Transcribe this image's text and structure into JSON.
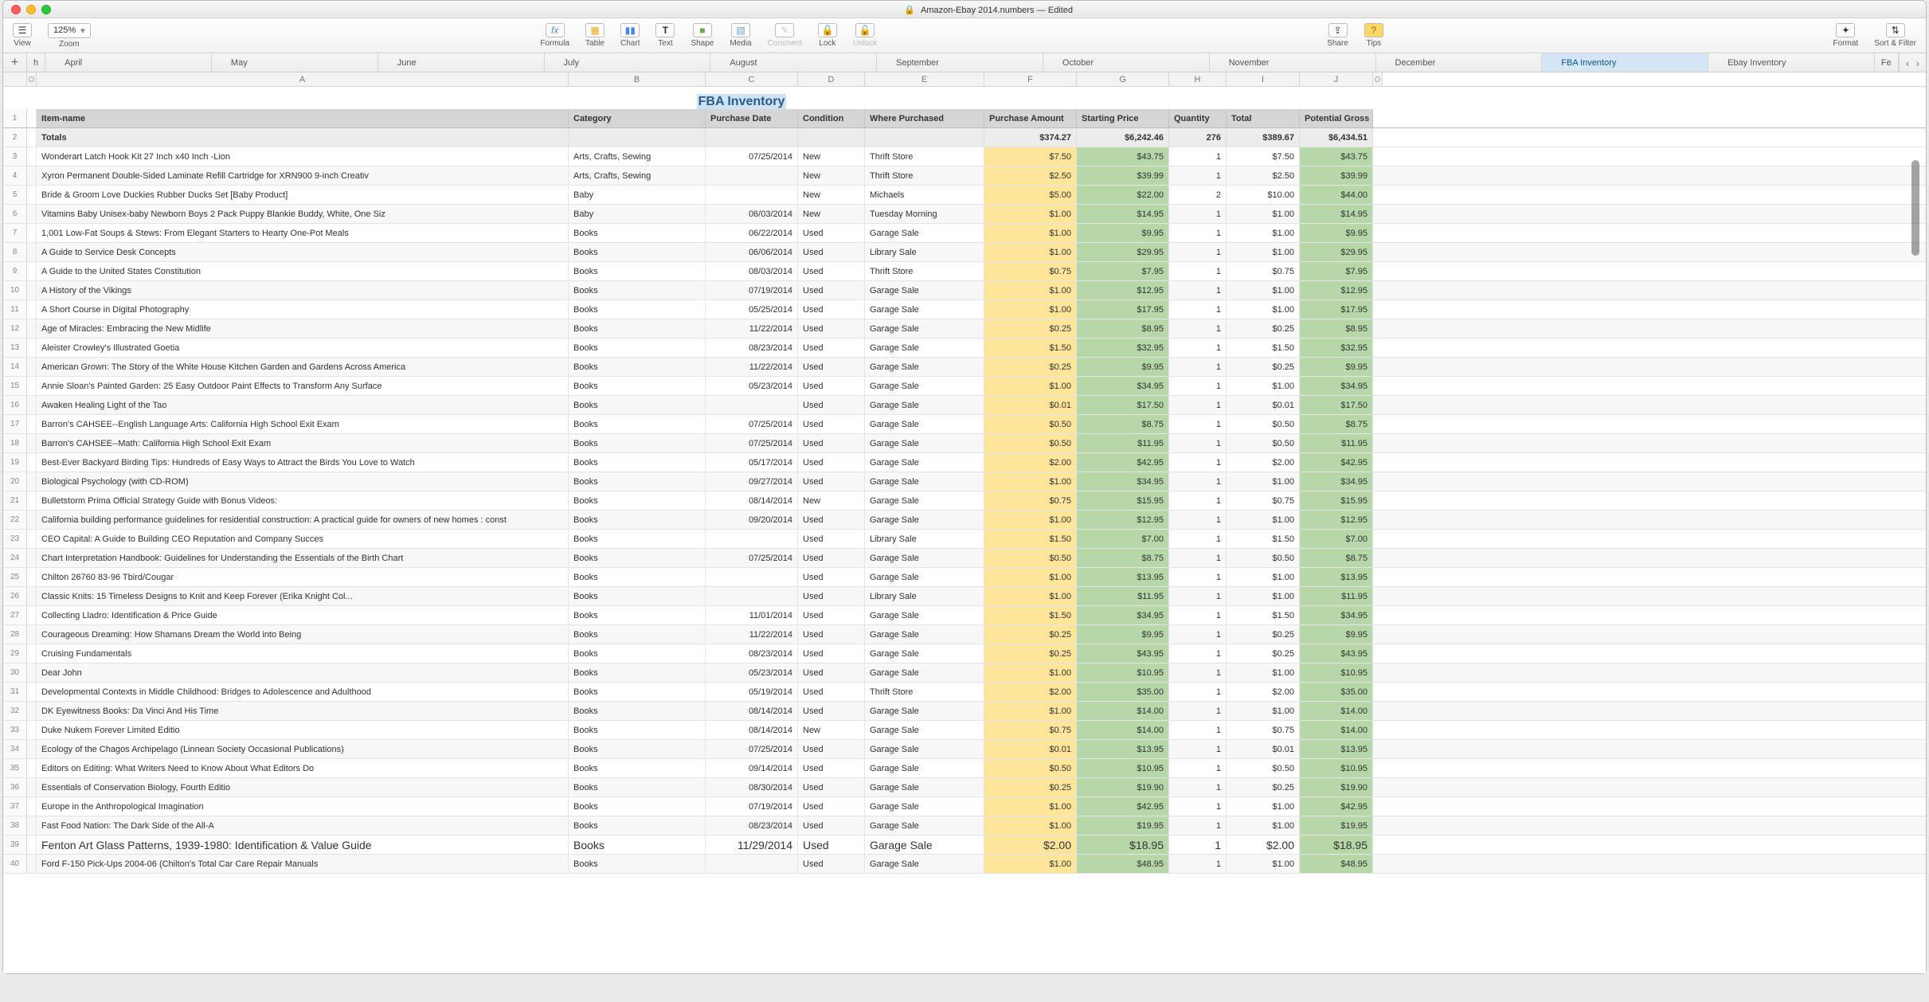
{
  "title_bar": {
    "icon": "🔒",
    "name": "Amazon-Ebay 2014.numbers",
    "status": "— Edited"
  },
  "toolbar": {
    "view": "View",
    "zoom": "Zoom",
    "zoom_value": "125%",
    "formula": "Formula",
    "table": "Table",
    "chart": "Chart",
    "text": "Text",
    "shape": "Shape",
    "media": "Media",
    "comment": "Comment",
    "lock": "Lock",
    "unlock": "Unlock",
    "share": "Share",
    "tips": "Tips",
    "format": "Format",
    "sort": "Sort & Filter"
  },
  "sheets": [
    "h",
    "April",
    "May",
    "June",
    "July",
    "August",
    "September",
    "October",
    "November",
    "December",
    "FBA Inventory",
    "Ebay Inventory",
    "Fe"
  ],
  "active_sheet": "FBA Inventory",
  "table_title": "FBA Inventory",
  "columns": [
    "",
    "A",
    "B",
    "C",
    "D",
    "E",
    "F",
    "G",
    "H",
    "I",
    "J",
    ""
  ],
  "headers": [
    "Item-name",
    "Category",
    "Purchase Date",
    "Condition",
    "Where Purchased",
    "Purchase Amount",
    "Starting Price",
    "Quantity",
    "Total",
    "Potential Gross"
  ],
  "totals": {
    "label": "Totals",
    "f": "$374.27",
    "g": "$6,242.46",
    "h": "276",
    "i": "$389.67",
    "j": "$6,434.51"
  },
  "rows": [
    {
      "a": "Wonderart Latch Hook Kit 27 Inch x40 Inch -Lion",
      "b": "Arts, Crafts, Sewing",
      "c": "07/25/2014",
      "d": "New",
      "e": "Thrift Store",
      "f": "$7.50",
      "g": "$43.75",
      "h": "1",
      "i": "$7.50",
      "j": "$43.75"
    },
    {
      "a": "Xyron Permanent Double-Sided Laminate Refill Cartridge for XRN900 9-inch Creativ",
      "b": "Arts, Crafts, Sewing",
      "c": "",
      "d": "New",
      "e": "Thrift Store",
      "f": "$2.50",
      "g": "$39.99",
      "h": "1",
      "i": "$2.50",
      "j": "$39.99"
    },
    {
      "a": "Bride & Groom Love Duckies Rubber Ducks Set [Baby Product]",
      "b": "Baby",
      "c": "",
      "d": "New",
      "e": "Michaels",
      "f": "$5.00",
      "g": "$22.00",
      "h": "2",
      "i": "$10.00",
      "j": "$44.00"
    },
    {
      "a": "Vitamins Baby Unisex-baby Newborn Boys 2 Pack Puppy Blankie Buddy, White, One Siz",
      "b": "Baby",
      "c": "06/03/2014",
      "d": "New",
      "e": "Tuesday Morning",
      "f": "$1.00",
      "g": "$14.95",
      "h": "1",
      "i": "$1.00",
      "j": "$14.95"
    },
    {
      "a": "1,001 Low-Fat Soups & Stews: From Elegant Starters to Hearty One-Pot Meals",
      "b": "Books",
      "c": "06/22/2014",
      "d": "Used",
      "e": "Garage Sale",
      "f": "$1.00",
      "g": "$9.95",
      "h": "1",
      "i": "$1.00",
      "j": "$9.95"
    },
    {
      "a": "A Guide to Service Desk Concepts",
      "b": "Books",
      "c": "06/06/2014",
      "d": "Used",
      "e": "Library Sale",
      "f": "$1.00",
      "g": "$29.95",
      "h": "1",
      "i": "$1.00",
      "j": "$29.95"
    },
    {
      "a": "A Guide to the United States Constitution",
      "b": "Books",
      "c": "08/03/2014",
      "d": "Used",
      "e": "Thrift Store",
      "f": "$0.75",
      "g": "$7.95",
      "h": "1",
      "i": "$0.75",
      "j": "$7.95"
    },
    {
      "a": "A History of the Vikings",
      "b": "Books",
      "c": "07/19/2014",
      "d": "Used",
      "e": "Garage Sale",
      "f": "$1.00",
      "g": "$12.95",
      "h": "1",
      "i": "$1.00",
      "j": "$12.95"
    },
    {
      "a": "A Short Course in Digital Photography",
      "b": "Books",
      "c": "05/25/2014",
      "d": "Used",
      "e": "Garage Sale",
      "f": "$1.00",
      "g": "$17.95",
      "h": "1",
      "i": "$1.00",
      "j": "$17.95"
    },
    {
      "a": "Age of Miracles: Embracing the New Midlife",
      "b": "Books",
      "c": "11/22/2014",
      "d": "Used",
      "e": "Garage Sale",
      "f": "$0.25",
      "g": "$8.95",
      "h": "1",
      "i": "$0.25",
      "j": "$8.95"
    },
    {
      "a": "Aleister Crowley's Illustrated Goetia",
      "b": "Books",
      "c": "08/23/2014",
      "d": "Used",
      "e": "Garage Sale",
      "f": "$1.50",
      "g": "$32.95",
      "h": "1",
      "i": "$1.50",
      "j": "$32.95"
    },
    {
      "a": "American Grown: The Story of the White House Kitchen Garden and Gardens Across America",
      "b": "Books",
      "c": "11/22/2014",
      "d": "Used",
      "e": "Garage Sale",
      "f": "$0.25",
      "g": "$9.95",
      "h": "1",
      "i": "$0.25",
      "j": "$9.95"
    },
    {
      "a": "Annie Sloan's Painted Garden: 25 Easy Outdoor Paint Effects to Transform Any Surface",
      "b": "Books",
      "c": "05/23/2014",
      "d": "Used",
      "e": "Garage Sale",
      "f": "$1.00",
      "g": "$34.95",
      "h": "1",
      "i": "$1.00",
      "j": "$34.95"
    },
    {
      "a": "Awaken Healing Light of the Tao",
      "b": "Books",
      "c": "",
      "d": "Used",
      "e": "Garage Sale",
      "f": "$0.01",
      "g": "$17.50",
      "h": "1",
      "i": "$0.01",
      "j": "$17.50"
    },
    {
      "a": "Barron's CAHSEE--English Language Arts: California High School Exit Exam",
      "b": "Books",
      "c": "07/25/2014",
      "d": "Used",
      "e": "Garage Sale",
      "f": "$0.50",
      "g": "$8.75",
      "h": "1",
      "i": "$0.50",
      "j": "$8.75"
    },
    {
      "a": "Barron's CAHSEE--Math: California High School Exit Exam",
      "b": "Books",
      "c": "07/25/2014",
      "d": "Used",
      "e": "Garage Sale",
      "f": "$0.50",
      "g": "$11.95",
      "h": "1",
      "i": "$0.50",
      "j": "$11.95"
    },
    {
      "a": "Best-Ever Backyard Birding Tips: Hundreds of Easy Ways to Attract the Birds You Love to Watch",
      "b": "Books",
      "c": "05/17/2014",
      "d": "Used",
      "e": "Garage Sale",
      "f": "$2.00",
      "g": "$42.95",
      "h": "1",
      "i": "$2.00",
      "j": "$42.95"
    },
    {
      "a": "Biological Psychology (with CD-ROM)",
      "b": "Books",
      "c": "09/27/2014",
      "d": "Used",
      "e": "Garage Sale",
      "f": "$1.00",
      "g": "$34.95",
      "h": "1",
      "i": "$1.00",
      "j": "$34.95"
    },
    {
      "a": "Bulletstorm Prima Official Strategy Guide with Bonus Videos:",
      "b": "Books",
      "c": "08/14/2014",
      "d": "New",
      "e": "Garage Sale",
      "f": "$0.75",
      "g": "$15.95",
      "h": "1",
      "i": "$0.75",
      "j": "$15.95"
    },
    {
      "a": "California building performance guidelines for residential construction: A practical guide for owners of new homes : const",
      "b": "Books",
      "c": "09/20/2014",
      "d": "Used",
      "e": "Garage Sale",
      "f": "$1.00",
      "g": "$12.95",
      "h": "1",
      "i": "$1.00",
      "j": "$12.95"
    },
    {
      "a": "CEO Capital: A Guide to Building CEO Reputation and Company Succes",
      "b": "Books",
      "c": "",
      "d": "Used",
      "e": "Library Sale",
      "f": "$1.50",
      "g": "$7.00",
      "h": "1",
      "i": "$1.50",
      "j": "$7.00"
    },
    {
      "a": "Chart Interpretation Handbook: Guidelines for Understanding the Essentials of the Birth Chart",
      "b": "Books",
      "c": "07/25/2014",
      "d": "Used",
      "e": "Garage Sale",
      "f": "$0.50",
      "g": "$8.75",
      "h": "1",
      "i": "$0.50",
      "j": "$8.75"
    },
    {
      "a": "Chilton 26760 83-96 Tbird/Cougar",
      "b": "Books",
      "c": "",
      "d": "Used",
      "e": "Garage Sale",
      "f": "$1.00",
      "g": "$13.95",
      "h": "1",
      "i": "$1.00",
      "j": "$13.95"
    },
    {
      "a": "Classic Knits: 15 Timeless Designs to Knit and Keep Forever (Erika Knight Col...",
      "b": "Books",
      "c": "",
      "d": "Used",
      "e": "Library Sale",
      "f": "$1.00",
      "g": "$11.95",
      "h": "1",
      "i": "$1.00",
      "j": "$11.95"
    },
    {
      "a": "Collecting Lladro: Identification & Price Guide",
      "b": "Books",
      "c": "11/01/2014",
      "d": "Used",
      "e": "Garage Sale",
      "f": "$1.50",
      "g": "$34.95",
      "h": "1",
      "i": "$1.50",
      "j": "$34.95"
    },
    {
      "a": "Courageous Dreaming: How Shamans Dream the World into Being",
      "b": "Books",
      "c": "11/22/2014",
      "d": "Used",
      "e": "Garage Sale",
      "f": "$0.25",
      "g": "$9.95",
      "h": "1",
      "i": "$0.25",
      "j": "$9.95"
    },
    {
      "a": "Cruising Fundamentals",
      "b": "Books",
      "c": "08/23/2014",
      "d": "Used",
      "e": "Garage Sale",
      "f": "$0.25",
      "g": "$43.95",
      "h": "1",
      "i": "$0.25",
      "j": "$43.95"
    },
    {
      "a": "Dear John",
      "b": "Books",
      "c": "05/23/2014",
      "d": "Used",
      "e": "Garage Sale",
      "f": "$1.00",
      "g": "$10.95",
      "h": "1",
      "i": "$1.00",
      "j": "$10.95"
    },
    {
      "a": "Developmental Contexts in Middle Childhood: Bridges to Adolescence and Adulthood",
      "b": "Books",
      "c": "05/19/2014",
      "d": "Used",
      "e": "Thrift Store",
      "f": "$2.00",
      "g": "$35.00",
      "h": "1",
      "i": "$2.00",
      "j": "$35.00"
    },
    {
      "a": "DK Eyewitness Books: Da Vinci And His Time",
      "b": "Books",
      "c": "08/14/2014",
      "d": "Used",
      "e": "Garage Sale",
      "f": "$1.00",
      "g": "$14.00",
      "h": "1",
      "i": "$1.00",
      "j": "$14.00"
    },
    {
      "a": "Duke Nukem Forever Limited Editio",
      "b": "Books",
      "c": "08/14/2014",
      "d": "New",
      "e": "Garage Sale",
      "f": "$0.75",
      "g": "$14.00",
      "h": "1",
      "i": "$0.75",
      "j": "$14.00"
    },
    {
      "a": "Ecology of the Chagos Archipelago (Linnean Society Occasional Publications)",
      "b": "Books",
      "c": "07/25/2014",
      "d": "Used",
      "e": "Garage Sale",
      "f": "$0.01",
      "g": "$13.95",
      "h": "1",
      "i": "$0.01",
      "j": "$13.95"
    },
    {
      "a": "Editors on Editing: What Writers Need to Know About What Editors Do",
      "b": "Books",
      "c": "09/14/2014",
      "d": "Used",
      "e": "Garage Sale",
      "f": "$0.50",
      "g": "$10.95",
      "h": "1",
      "i": "$0.50",
      "j": "$10.95"
    },
    {
      "a": "Essentials of Conservation Biology, Fourth Editio",
      "b": "Books",
      "c": "08/30/2014",
      "d": "Used",
      "e": "Garage Sale",
      "f": "$0.25",
      "g": "$19.90",
      "h": "1",
      "i": "$0.25",
      "j": "$19.90"
    },
    {
      "a": "Europe in the Anthropological Imagination",
      "b": "Books",
      "c": "07/19/2014",
      "d": "Used",
      "e": "Garage Sale",
      "f": "$1.00",
      "g": "$42.95",
      "h": "1",
      "i": "$1.00",
      "j": "$42.95"
    },
    {
      "a": "Fast Food Nation: The Dark Side of the All-A",
      "b": "Books",
      "c": "08/23/2014",
      "d": "Used",
      "e": "Garage Sale",
      "f": "$1.00",
      "g": "$19.95",
      "h": "1",
      "i": "$1.00",
      "j": "$19.95"
    },
    {
      "a": "Fenton Art Glass Patterns, 1939-1980: Identification & Value Guide",
      "b": "Books",
      "c": "11/29/2014",
      "d": "Used",
      "e": "Garage Sale",
      "f": "$2.00",
      "g": "$18.95",
      "h": "1",
      "i": "$2.00",
      "j": "$18.95",
      "big": true
    },
    {
      "a": "Ford F-150 Pick-Ups 2004-06 (Chilton's Total Car Care Repair Manuals",
      "b": "Books",
      "c": "",
      "d": "Used",
      "e": "Garage Sale",
      "f": "$1.00",
      "g": "$48.95",
      "h": "1",
      "i": "$1.00",
      "j": "$48.95"
    }
  ]
}
